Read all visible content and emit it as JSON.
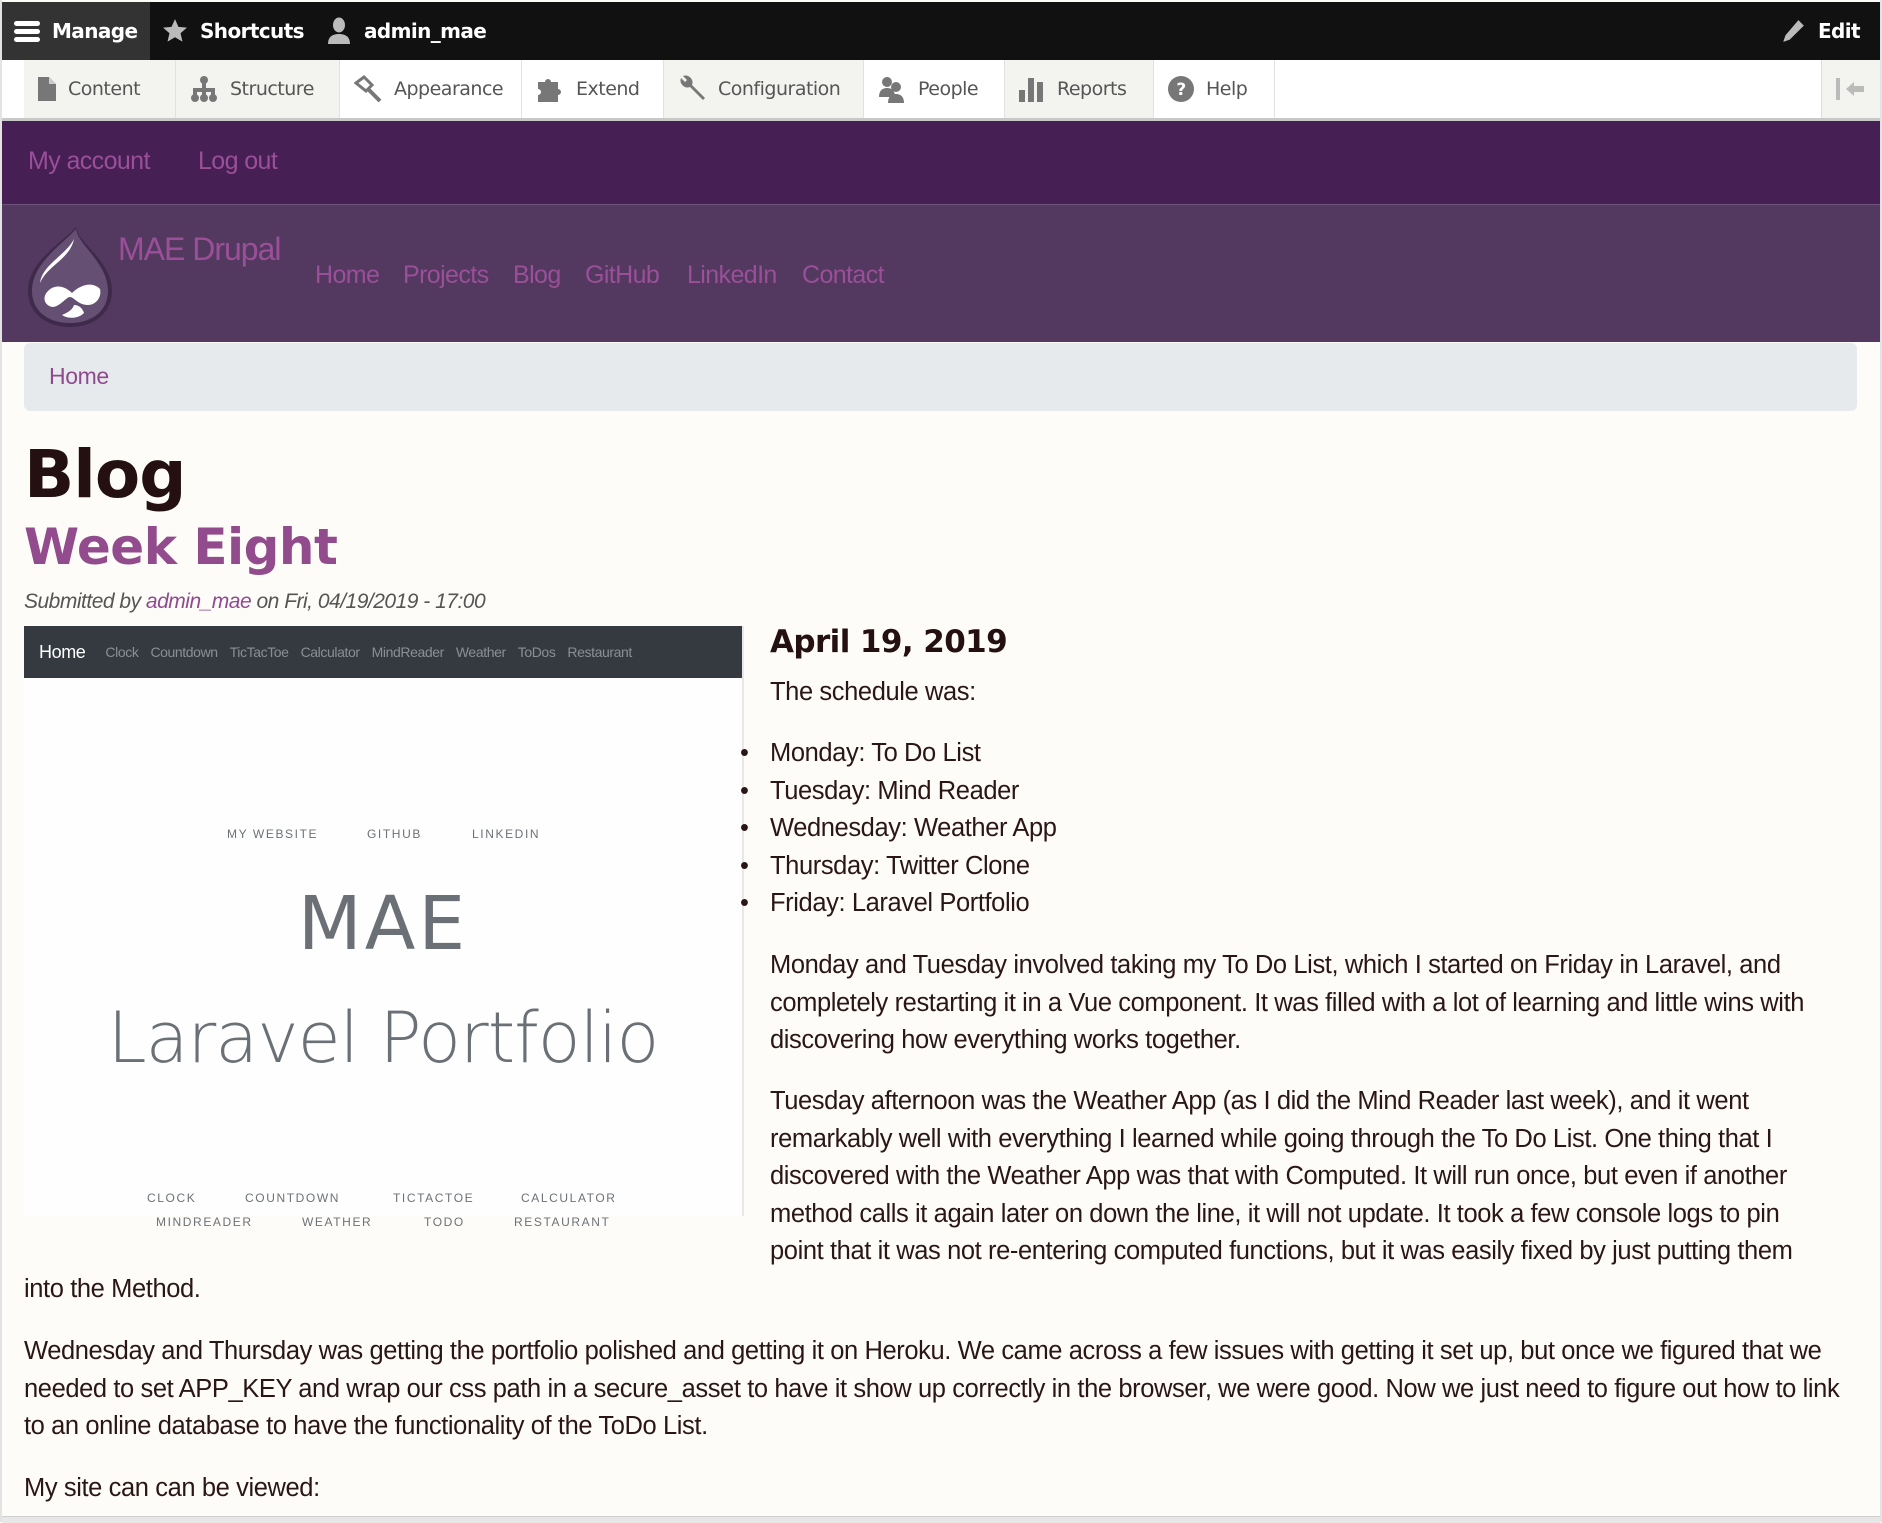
{
  "toolbar": {
    "manage": "Manage",
    "shortcuts": "Shortcuts",
    "user": "admin_mae",
    "edit": "Edit",
    "tray": [
      {
        "label": "Content",
        "icon": "file-icon"
      },
      {
        "label": "Structure",
        "icon": "sitemap-icon"
      },
      {
        "label": "Appearance",
        "icon": "paintbrush-icon"
      },
      {
        "label": "Extend",
        "icon": "puzzle-icon"
      },
      {
        "label": "Configuration",
        "icon": "wrench-icon"
      },
      {
        "label": "People",
        "icon": "people-icon"
      },
      {
        "label": "Reports",
        "icon": "bar-chart-icon"
      },
      {
        "label": "Help",
        "icon": "help-icon"
      }
    ]
  },
  "secondary_menu": {
    "my_account": "My account",
    "log_out": "Log out"
  },
  "site": {
    "name": "MAE Drupal",
    "nav": [
      "Home",
      "Projects",
      "Blog",
      "GitHub",
      "LinkedIn",
      "Contact"
    ]
  },
  "breadcrumb": {
    "home": "Home"
  },
  "page": {
    "title": "Blog",
    "node_title": "Week Eight",
    "submitted_prefix": "Submitted by",
    "author": "admin_mae",
    "submitted_suffix": "on Fri, 04/19/2019 - 17:00"
  },
  "screenshot_image": {
    "nav_home": "Home",
    "nav_items": [
      "Clock",
      "Countdown",
      "TicTacToe",
      "Calculator",
      "MindReader",
      "Weather",
      "ToDos",
      "Restaurant"
    ],
    "top_links": [
      "MY WEBSITE",
      "GITHUB",
      "LINKEDIN"
    ],
    "heading": "MAE",
    "subheading": "Laravel Portfolio",
    "bottom_row1": [
      "CLOCK",
      "COUNTDOWN",
      "TICTACTOE",
      "CALCULATOR"
    ],
    "bottom_row2": [
      "MINDREADER",
      "WEATHER",
      "TODO",
      "RESTAURANT"
    ]
  },
  "article": {
    "date": "April 19, 2019",
    "schedule_intro": "The schedule was:",
    "schedule": [
      "Monday: To Do List",
      "Tuesday: Mind Reader",
      "Wednesday: Weather App",
      "Thursday: Twitter Clone",
      "Friday: Laravel Portfolio"
    ],
    "para1_lines": [
      "Monday and Tuesday involved taking my To Do List, which I started on Friday in Laravel, and",
      "completely restarting it in a Vue component. It was filled with a lot of learning and little wins with",
      "discovering how everything works together."
    ],
    "para2_lines": [
      "Tuesday afternoon was the Weather App (as I did the Mind Reader last week), and it went",
      "remarkably well with everything I learned while going through the To Do List. One thing that I",
      "discovered with the Weather App was that with Computed. It will run once, but even if another",
      "method calls it again later on down the line, it will not update. It took a few console logs to pin",
      "point that it was not re-entering computed functions, but it was easily fixed by just putting them"
    ],
    "para2_tail": "into the Method.",
    "para3_lines": [
      "Wednesday and Thursday was getting the portfolio polished and getting it on Heroku. We came across a few issues with getting it set up, but once we figured that we",
      "needed to set APP_KEY and wrap our css path in a secure_asset to have it show up correctly in the browser, we were good. Now we just need to figure out how to link",
      "to an online database to have the functionality of the ToDo List."
    ],
    "para4": "My site can can be viewed:"
  }
}
